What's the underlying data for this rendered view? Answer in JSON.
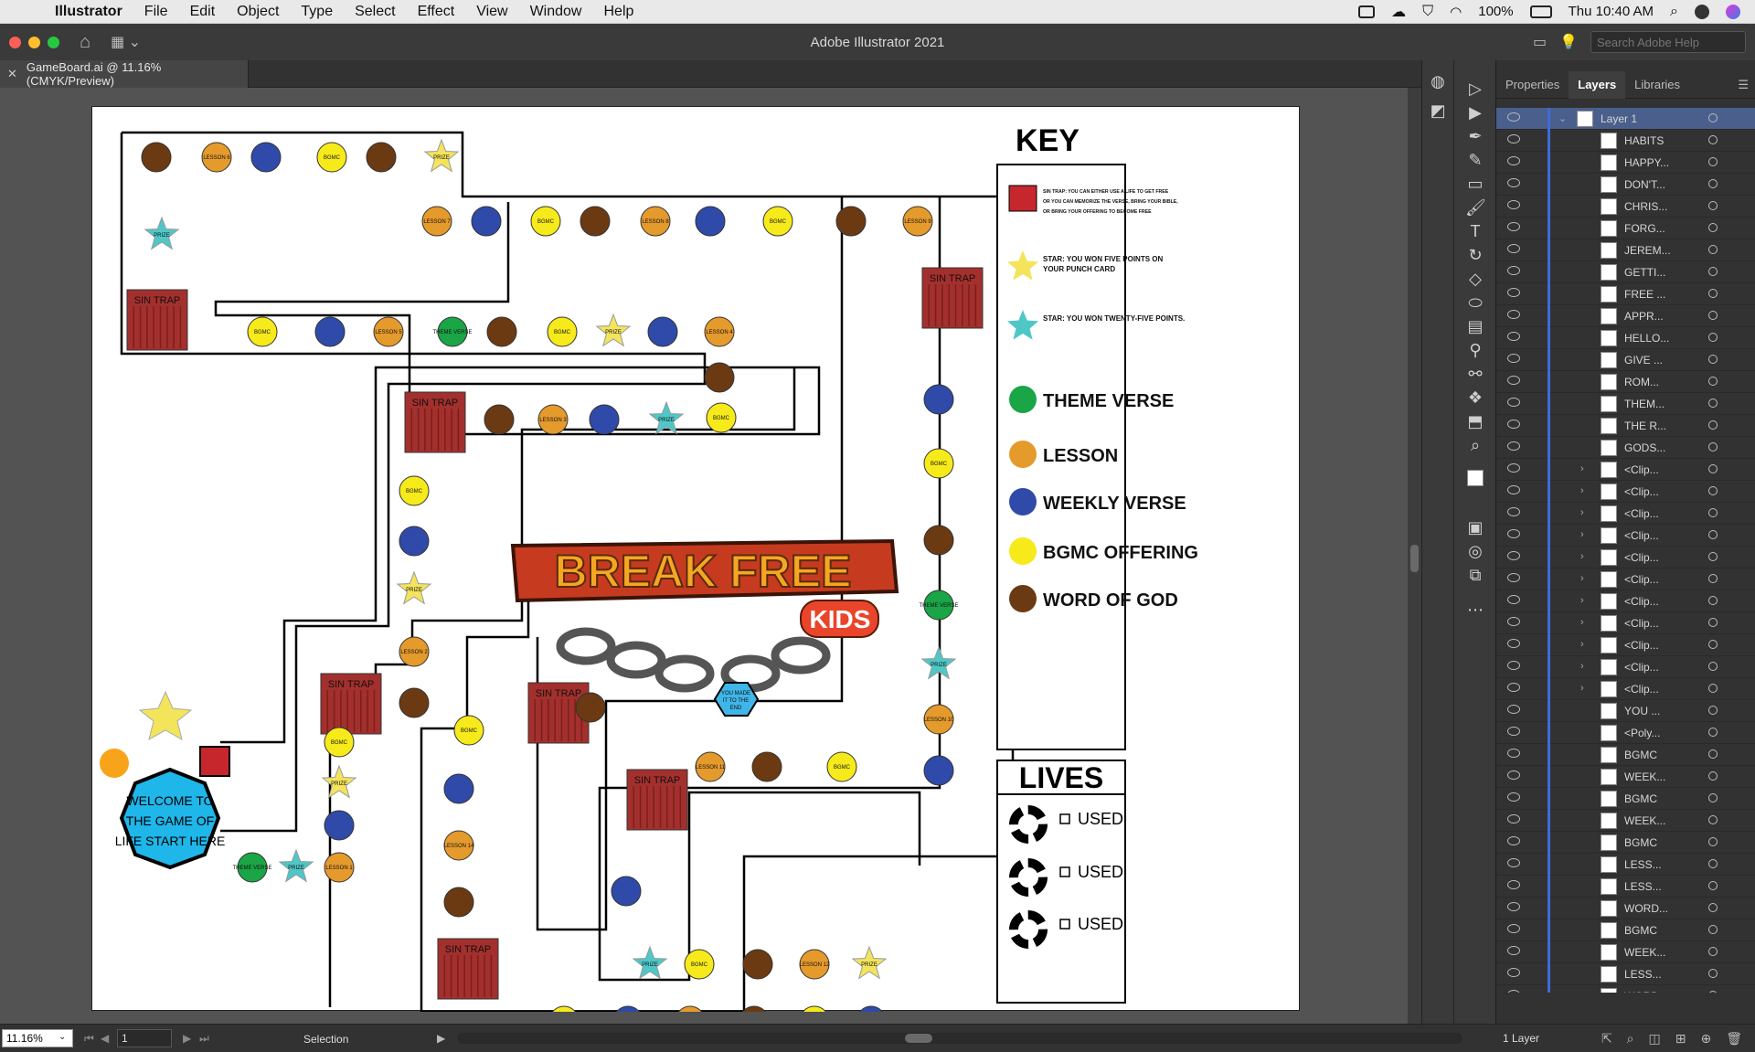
{
  "menubar": {
    "app": "Illustrator",
    "items": [
      "File",
      "Edit",
      "Object",
      "Type",
      "Select",
      "Effect",
      "View",
      "Window",
      "Help"
    ],
    "battery": "100%",
    "clock": "Thu 10:40 AM"
  },
  "titlebar": {
    "title": "Adobe Illustrator 2021",
    "search_placeholder": "Search Adobe Help"
  },
  "document": {
    "tab_label": "GameBoard.ai @ 11.16% (CMYK/Preview)"
  },
  "panels": {
    "tabs": [
      "Properties",
      "Layers",
      "Libraries"
    ],
    "active_tab": "Layers",
    "layers": [
      {
        "name": "Layer 1",
        "expandable": true,
        "expanded": true,
        "top": true
      },
      {
        "name": "HABITS"
      },
      {
        "name": "HAPPY..."
      },
      {
        "name": "DON'T..."
      },
      {
        "name": "CHRIS..."
      },
      {
        "name": "FORG..."
      },
      {
        "name": "JEREM..."
      },
      {
        "name": "GETTI..."
      },
      {
        "name": "FREE ..."
      },
      {
        "name": "APPR..."
      },
      {
        "name": "HELLO..."
      },
      {
        "name": "GIVE ..."
      },
      {
        "name": "ROM..."
      },
      {
        "name": "THEM..."
      },
      {
        "name": "THE R..."
      },
      {
        "name": "GODS..."
      },
      {
        "name": "<Clip...",
        "expandable": true
      },
      {
        "name": "<Clip...",
        "expandable": true
      },
      {
        "name": "<Clip...",
        "expandable": true
      },
      {
        "name": "<Clip...",
        "expandable": true
      },
      {
        "name": "<Clip...",
        "expandable": true
      },
      {
        "name": "<Clip...",
        "expandable": true
      },
      {
        "name": "<Clip...",
        "expandable": true
      },
      {
        "name": "<Clip...",
        "expandable": true
      },
      {
        "name": "<Clip...",
        "expandable": true
      },
      {
        "name": "<Clip...",
        "expandable": true
      },
      {
        "name": "<Clip...",
        "expandable": true
      },
      {
        "name": "YOU ..."
      },
      {
        "name": "<Poly..."
      },
      {
        "name": "BGMC"
      },
      {
        "name": "WEEK..."
      },
      {
        "name": "BGMC"
      },
      {
        "name": "WEEK..."
      },
      {
        "name": "BGMC"
      },
      {
        "name": "LESS..."
      },
      {
        "name": "LESS..."
      },
      {
        "name": "WORD..."
      },
      {
        "name": "BGMC"
      },
      {
        "name": "WEEK..."
      },
      {
        "name": "LESS..."
      },
      {
        "name": "WORD..."
      }
    ],
    "footer_count": "1 Layer"
  },
  "statusbar": {
    "zoom": "11.16%",
    "page": "1",
    "tool": "Selection"
  },
  "board": {
    "key_title": "KEY",
    "key_items": [
      {
        "label": "SIN TRAP: YOU CAN EITHER USE A LIFE TO GET FREE",
        "label2": "OR YOU CAN MEMORIZE THE VERSE, BRING YOUR BIBLE,",
        "label3": "OR BRING YOUR OFFERING TO BECOME FREE",
        "kind": "trap"
      },
      {
        "label": "STAR: YOU WON FIVE POINTS ON",
        "label2": "YOUR PUNCH CARD",
        "kind": "star-yellow"
      },
      {
        "label": "STAR: YOU WON TWENTY-FIVE POINTS.",
        "kind": "star-teal"
      },
      {
        "label": "THEME VERSE",
        "kind": "green"
      },
      {
        "label": "LESSON",
        "kind": "orange"
      },
      {
        "label": "WEEKLY VERSE",
        "kind": "blue"
      },
      {
        "label": "BGMC OFFERING",
        "kind": "yellow"
      },
      {
        "label": "WORD OF GOD",
        "kind": "brown"
      }
    ],
    "lives_title": "LIVES",
    "lives": [
      "USED",
      "USED",
      "USED"
    ],
    "logo_line1": "BREAK FREE",
    "logo_line2": "KIDS",
    "start_text": [
      "WELCOME TO",
      "THE GAME OF",
      "LIFE START HERE"
    ],
    "end_text": [
      "YOU MADE",
      "IT TO THE",
      "END"
    ],
    "sin_trap": "SIN TRAP",
    "bgmc": "BGMC",
    "prize": "PRIZE",
    "word_of_god": "WORD OF GOD",
    "lessons": [
      "LESSON 1",
      "LESSON 2",
      "LESSON 3",
      "LESSON 4",
      "LESSON 5",
      "LESSON 6",
      "LESSON 7",
      "LESSON 8",
      "LESSON 9",
      "LESSON 10",
      "LESSON 11",
      "LESSON 12",
      "LESSON 13",
      "LESSON 14"
    ],
    "theme_verse": "THEME VERSE"
  },
  "colors": {
    "green": "#1aa546",
    "orange": "#e59a2c",
    "blue": "#2f4aa8",
    "yellow": "#f7ea1b",
    "brown": "#6b3a12",
    "star_yellow": "#f3e45c",
    "star_teal": "#4fc7c7",
    "trap": "#a3302d",
    "start": "#1fb6e9"
  }
}
